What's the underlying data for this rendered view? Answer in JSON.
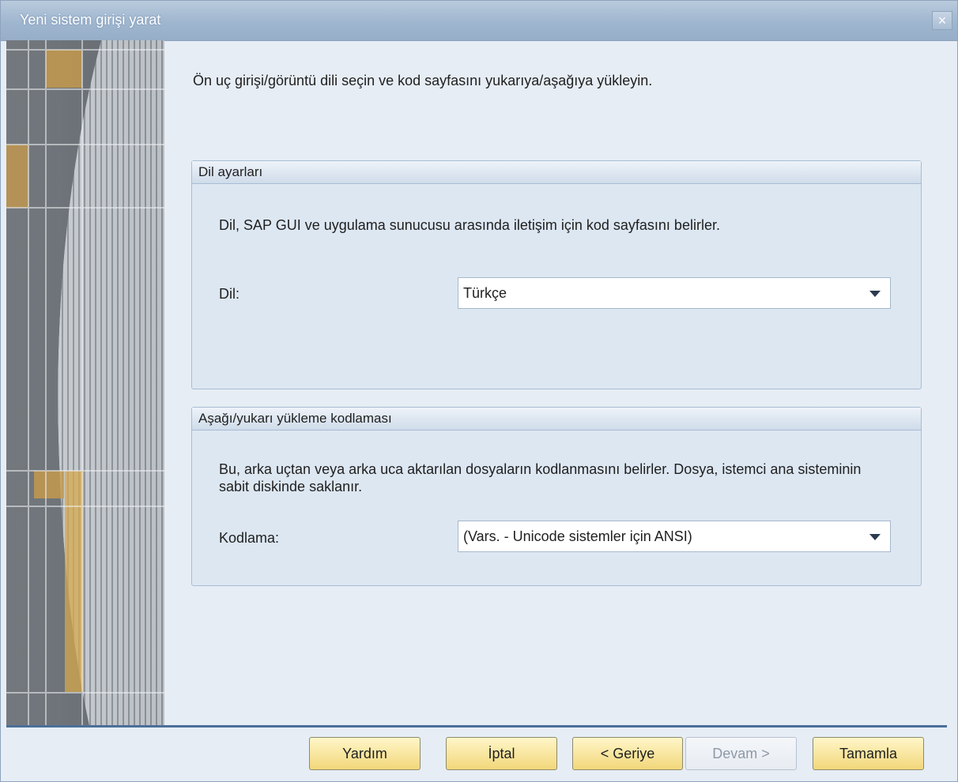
{
  "window": {
    "title": "Yeni sistem girişi yarat"
  },
  "instruction": "Ön uç girişi/görüntü dili seçin ve kod sayfasını yukarıya/aşağıya yükleyin.",
  "language_group": {
    "title": "Dil ayarları",
    "description": "Dil, SAP GUI ve uygulama sunucusu arasında iletişim için kod sayfasını belirler.",
    "label": "Dil:",
    "value": "Türkçe"
  },
  "encoding_group": {
    "title": "Aşağı/yukarı yükleme kodlaması",
    "description": "Bu, arka uçtan veya arka uca aktarılan dosyaların kodlanmasını belirler. Dosya, istemci ana sisteminin sabit diskinde saklanır.",
    "label": "Kodlama:",
    "value": "(Vars. - Unicode sistemler için ANSI)"
  },
  "buttons": {
    "help": "Yardım",
    "cancel": "İptal",
    "back": "< Geriye",
    "next": "Devam >",
    "finish": "Tamamla"
  },
  "colors": {
    "accent": "#f2d77a",
    "panel": "#dde7f2",
    "titlebar": "#9fb6cf"
  }
}
